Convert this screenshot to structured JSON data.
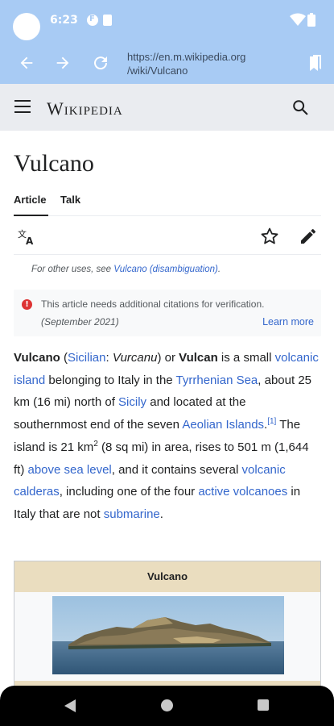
{
  "status_bar": {
    "time": "6:23"
  },
  "browser": {
    "url_line1": "https://en.m.wikipedia.org",
    "url_line2": "/wiki/Vulcano"
  },
  "wiki": {
    "logo": "Wikipedia"
  },
  "article": {
    "title": "Vulcano",
    "tabs": [
      {
        "label": "Article"
      },
      {
        "label": "Talk"
      }
    ],
    "hatnote_prefix": "For other uses, see ",
    "hatnote_link": "Vulcano (disambiguation)",
    "hatnote_suffix": ".",
    "notice_message": "This article needs additional citations for verification.",
    "notice_date": "(September 2021)",
    "notice_link": "Learn more",
    "infobox_title": "Vulcano"
  },
  "paragraph": {
    "t1": "Vulcano",
    "t2": " (",
    "l1": "Sicilian",
    "t3": ": ",
    "t4": "Vurcanu",
    "t5": ") or ",
    "t6": "Vulcan",
    "t7": " is a small ",
    "l2": "volcanic island",
    "t8": " belonging to Italy in the ",
    "l3": "Tyrrhenian Sea",
    "t9": ", about 25 km (16 mi) north of ",
    "l4": "Sicily",
    "t10": " and located at the southernmost end of the seven ",
    "l5": "Aeolian Islands",
    "t11": ".",
    "ref": "[1]",
    "t12": " The island is 21 km",
    "sup2": "2",
    "t13": " (8 sq mi) in area, rises to 501 m (1,644 ft) ",
    "l6": "above sea level",
    "t14": ", and it contains several ",
    "l7": "volcanic calderas",
    "t15": ", including one of the four ",
    "l8": "active volcanoes",
    "t16": " in Italy that are not ",
    "l9": "submarine",
    "t17": "."
  },
  "colors": {
    "chrome": "#a8cbf4",
    "link": "#3366cc",
    "infobox_header": "#eaddbf"
  }
}
